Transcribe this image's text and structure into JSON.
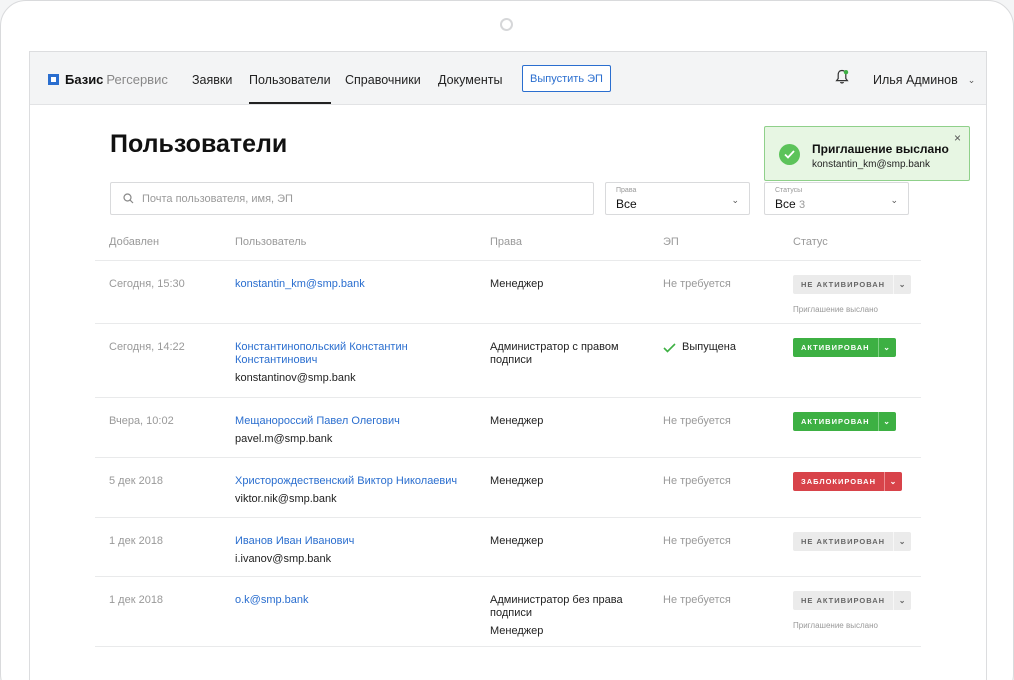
{
  "header": {
    "brand_bold": "Базис",
    "brand_light": "Регсервис",
    "nav": [
      {
        "label": "Заявки",
        "active": false
      },
      {
        "label": "Пользователи",
        "active": true
      },
      {
        "label": "Справочники",
        "active": false
      },
      {
        "label": "Документы",
        "active": false
      }
    ],
    "action_button": "Выпустить ЭП",
    "user_name": "Илья Админов",
    "icons": {
      "bell": "bell-icon",
      "chevron": "chevron-down-icon"
    }
  },
  "page": {
    "title": "Пользователи",
    "search": {
      "placeholder": "Почта пользователя, имя, ЭП",
      "value": ""
    },
    "filters": {
      "rights": {
        "label": "Права",
        "value": "Все"
      },
      "statuses": {
        "label": "Статусы",
        "value": "Все",
        "count": "3"
      }
    }
  },
  "table": {
    "columns": [
      "Добавлен",
      "Пользователь",
      "Права",
      "ЭП",
      "Статус"
    ],
    "rows": [
      {
        "added": "Сегодня, 15:30",
        "user_name": "",
        "user_email": "konstantin_km@smp.bank",
        "rights": [
          "Менеджер"
        ],
        "ep": "Не требуется",
        "ep_ok": false,
        "status": "НЕ АКТИВИРОВАН",
        "status_color": "gray",
        "note": "Приглашение выслано"
      },
      {
        "added": "Сегодня, 14:22",
        "user_name": "Константинопольский Константин Константинович",
        "user_email": "konstantinov@smp.bank",
        "rights": [
          "Администратор с правом подписи"
        ],
        "ep": "Выпущена",
        "ep_ok": true,
        "status": "АКТИВИРОВАН",
        "status_color": "green",
        "note": ""
      },
      {
        "added": "Вчера, 10:02",
        "user_name": "Мещанороссий Павел Олегович",
        "user_email": "pavel.m@smp.bank",
        "rights": [
          "Менеджер"
        ],
        "ep": "Не требуется",
        "ep_ok": false,
        "status": "АКТИВИРОВАН",
        "status_color": "green",
        "note": ""
      },
      {
        "added": "5 дек 2018",
        "user_name": "Христорождественский Виктор Николаевич",
        "user_email": "viktor.nik@smp.bank",
        "rights": [
          "Менеджер"
        ],
        "ep": "Не требуется",
        "ep_ok": false,
        "status": "ЗАБЛОКИРОВАН",
        "status_color": "red",
        "note": ""
      },
      {
        "added": "1 дек 2018",
        "user_name": "Иванов Иван Иванович",
        "user_email": "i.ivanov@smp.bank",
        "rights": [
          "Менеджер"
        ],
        "ep": "Не требуется",
        "ep_ok": false,
        "status": "НЕ АКТИВИРОВАН",
        "status_color": "gray",
        "note": ""
      },
      {
        "added": "1 дек 2018",
        "user_name": "",
        "user_email": "o.k@smp.bank",
        "rights": [
          "Администратор без права подписи",
          "Менеджер"
        ],
        "ep": "Не требуется",
        "ep_ok": false,
        "status": "НЕ АКТИВИРОВАН",
        "status_color": "gray",
        "note": "Приглашение выслано"
      }
    ]
  },
  "toast": {
    "title": "Приглашение выслано",
    "subtitle": "konstantin_km@smp.bank"
  },
  "colors": {
    "accent": "#2a6ecf",
    "success": "#3db043",
    "danger": "#d8434a",
    "neutral": "#ebebeb"
  }
}
